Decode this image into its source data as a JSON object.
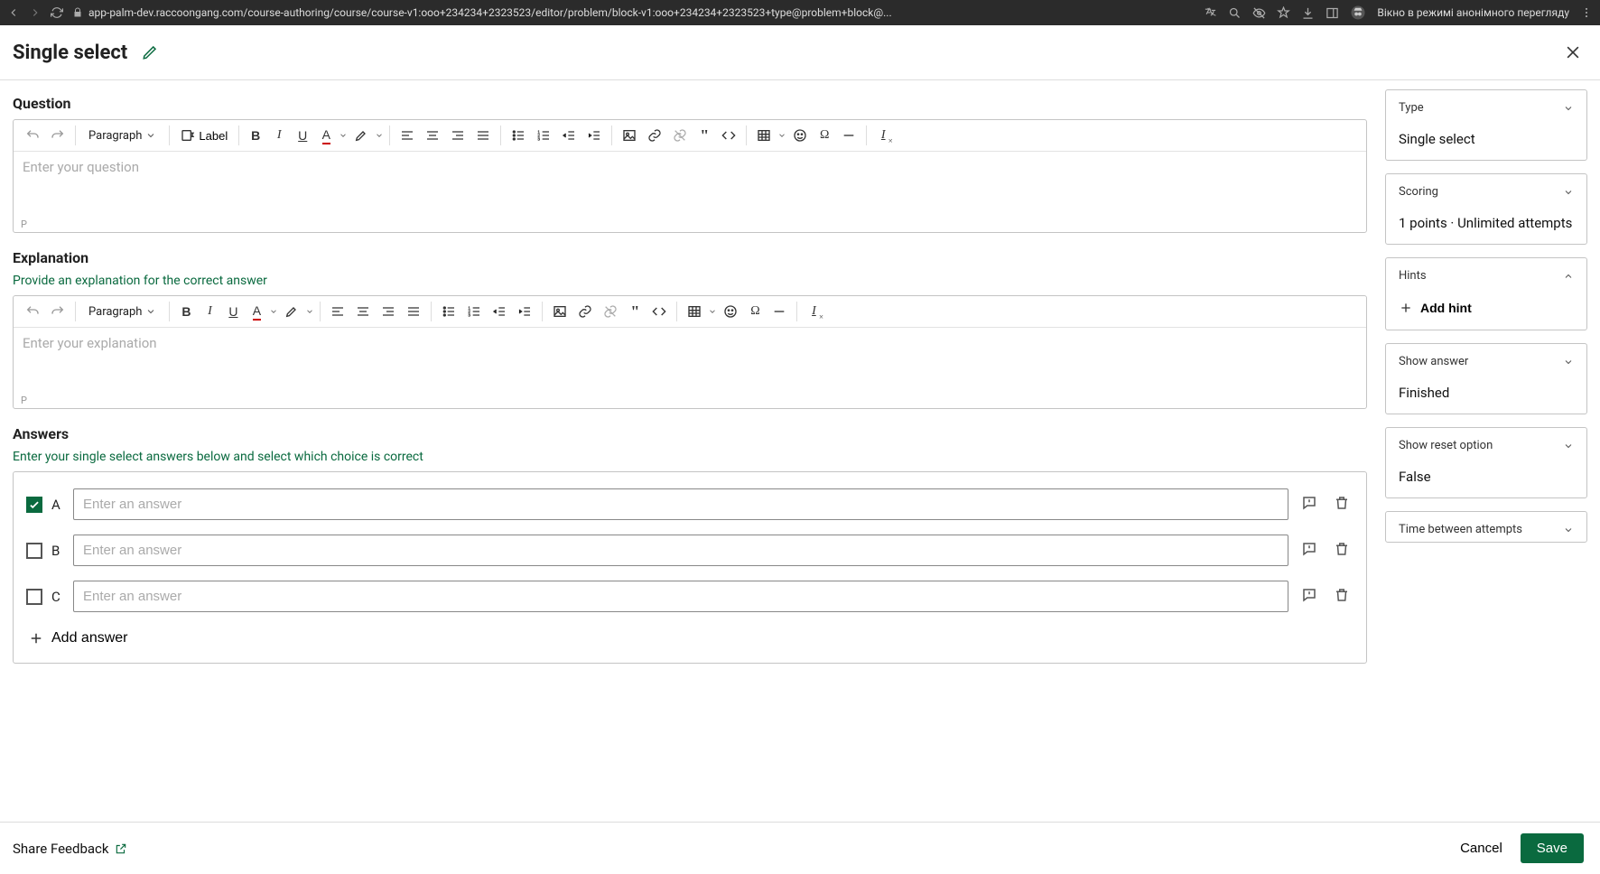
{
  "browser": {
    "url": "app-palm-dev.raccoongang.com/course-authoring/course/course-v1:ooo+234234+2323523/editor/problem/block-v1:ooo+234234+2323523+type@problem+block@...",
    "incognito_label": "Вікно в режимі анонімного перегляду"
  },
  "header": {
    "title": "Single select"
  },
  "question": {
    "heading": "Question",
    "style_select": "Paragraph",
    "label_btn": "Label",
    "placeholder": "Enter your question",
    "status": "P"
  },
  "explanation": {
    "heading": "Explanation",
    "subtext": "Provide an explanation for the correct answer",
    "style_select": "Paragraph",
    "placeholder": "Enter your explanation",
    "status": "P"
  },
  "answers": {
    "heading": "Answers",
    "subtext": "Enter your single select answers below and select which choice is correct",
    "rows": [
      {
        "letter": "A",
        "placeholder": "Enter an answer",
        "checked": true
      },
      {
        "letter": "B",
        "placeholder": "Enter an answer",
        "checked": false
      },
      {
        "letter": "C",
        "placeholder": "Enter an answer",
        "checked": false
      }
    ],
    "add_label": "Add answer"
  },
  "sidebar": {
    "type": {
      "label": "Type",
      "value": "Single select"
    },
    "scoring": {
      "label": "Scoring",
      "value": "1 points · Unlimited attempts"
    },
    "hints": {
      "label": "Hints",
      "add_label": "Add hint"
    },
    "show_answer": {
      "label": "Show answer",
      "value": "Finished"
    },
    "show_reset": {
      "label": "Show reset option",
      "value": "False"
    },
    "time_between": {
      "label": "Time between attempts"
    }
  },
  "footer": {
    "share": "Share Feedback",
    "cancel": "Cancel",
    "save": "Save"
  }
}
